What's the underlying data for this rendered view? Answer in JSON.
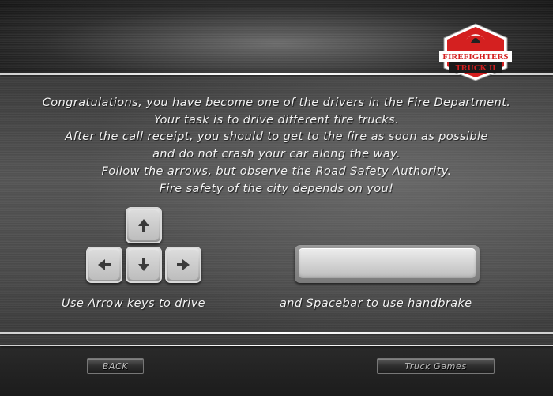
{
  "logo": {
    "line1": "FIREFIGHTERS",
    "line2": "TRUCK II"
  },
  "intro": {
    "lines": [
      "Congratulations, you have become one of the drivers in the Fire Department.",
      "Your task is to drive different fire trucks.",
      "After the call receipt, you should to get to the fire as soon as possible",
      "and do not crash your car along the way.",
      "Follow the arrows, but observe the Road Safety Authority.",
      "Fire safety of the city depends on you!"
    ]
  },
  "controls": {
    "arrow_caption": "Use Arrow keys to drive",
    "space_caption": "and Spacebar to use handbrake"
  },
  "footer": {
    "back_label": "BACK",
    "truck_games_label": "Truck Games"
  },
  "colors": {
    "logo_red": "#d42020",
    "text": "#f2f2f2"
  },
  "icons": {
    "up": "arrow-up-icon",
    "down": "arrow-down-icon",
    "left": "arrow-left-icon",
    "right": "arrow-right-icon"
  }
}
